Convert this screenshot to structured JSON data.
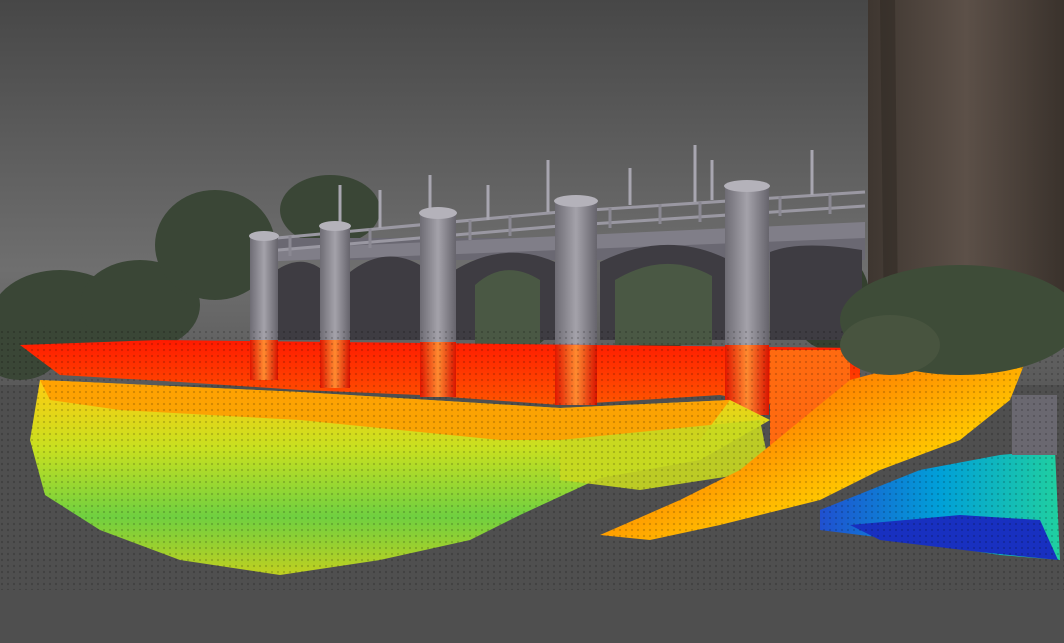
{
  "viewer": {
    "background_top": "#4a4a4a",
    "background_mid": "#6e6e6e",
    "ground_plane": "#505050"
  },
  "colormap": {
    "high": "#ff1a00",
    "upper": "#ff7a00",
    "mid": "#e8d000",
    "lower": "#40d040",
    "low": "#00b0d0",
    "deepest": "#1020c0"
  },
  "objects": {
    "structure_color": "#8c8a92",
    "foliage_color": "#3c4a38",
    "tree_trunk_color": "#4e443c"
  }
}
